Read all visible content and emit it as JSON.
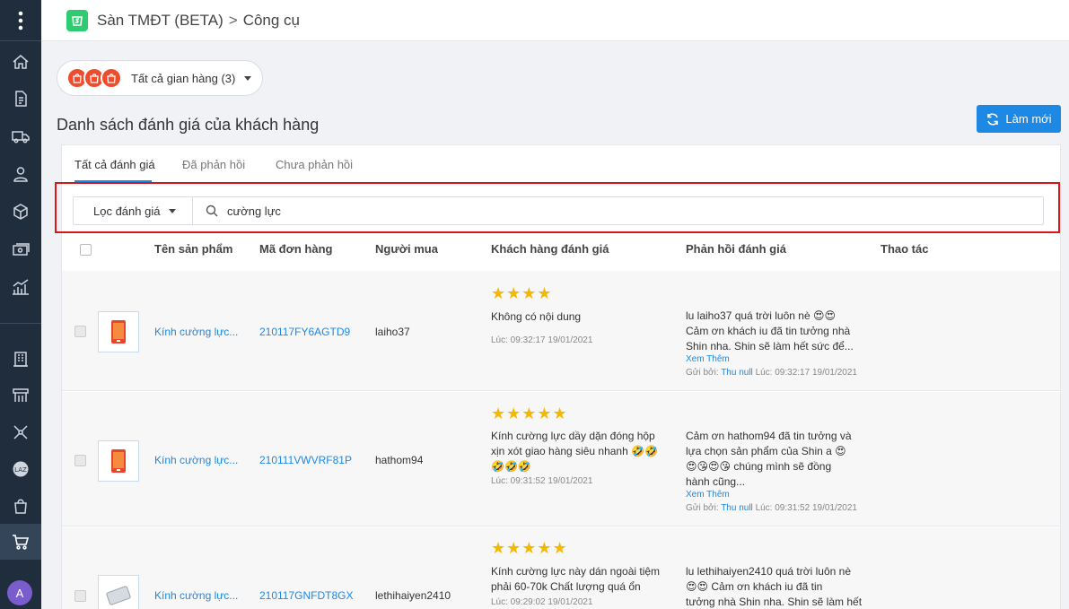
{
  "header": {
    "app": "Sàn TMĐT (BETA)",
    "separator": ">",
    "section": "Công cụ"
  },
  "shop_selector": {
    "label": "Tất cả gian hàng (3)"
  },
  "page_title": "Danh sách đánh giá của khách hàng",
  "refresh_label": "Làm mới",
  "tabs": [
    {
      "label": "Tất cả đánh giá"
    },
    {
      "label": "Đã phản hồi"
    },
    {
      "label": "Chưa phản hồi"
    }
  ],
  "filter": {
    "label": "Lọc đánh giá",
    "search_value": "cường lực"
  },
  "columns": {
    "product": "Tên sản phẩm",
    "order": "Mã đơn hàng",
    "buyer": "Người mua",
    "review": "Khách hàng đánh giá",
    "response": "Phản hồi đánh giá",
    "action": "Thao tác"
  },
  "rows": [
    {
      "product": "Kính cường lực...",
      "order": "210117FY6AGTD9",
      "buyer": "laiho37",
      "rating": 4,
      "stars": "★★★★",
      "review_lines": [
        "Không có nội dung"
      ],
      "review_time": "Lúc: 09:32:17 19/01/2021",
      "response_lines": [
        "lu laiho37 quá trời luôn nè 😍😍",
        "Cảm ơn khách iu đã tin tưởng nhà",
        "Shin nha. Shin sẽ làm hết sức để..."
      ],
      "more": "Xem Thêm",
      "sent_prefix": "Gửi bởi:",
      "sent_user": "Thu null",
      "sent_time": "Lúc: 09:32:17 19/01/2021"
    },
    {
      "product": "Kính cường lực...",
      "order": "210111VWVRF81P",
      "buyer": "hathom94",
      "rating": 5,
      "stars": "★★★★★",
      "review_lines": [
        "Kính cường lực dầy dặn đóng hộp",
        "xịn xót giao hàng siêu nhanh 🤣🤣",
        "🤣🤣🤣"
      ],
      "review_time": "Lúc: 09:31:52 19/01/2021",
      "response_lines": [
        "Cảm ơn hathom94 đã tin tưởng và",
        "lựa chọn sản phẩm của Shin a 😍",
        "😍😘😍😘 chúng mình sẽ đồng",
        "hành cũng..."
      ],
      "more": "Xem Thêm",
      "sent_prefix": "Gửi bởi:",
      "sent_user": "Thu null",
      "sent_time": "Lúc: 09:31:52 19/01/2021"
    },
    {
      "product": "Kính cường lực...",
      "order": "210117GNFDT8GX",
      "buyer": "lethihaiyen2410",
      "rating": 5,
      "stars": "★★★★★",
      "review_lines": [
        "Kính cường lực này dán ngoài tiệm",
        "phải 60-70k Chất lượng quá ổn"
      ],
      "review_time": "Lúc: 09:29:02 19/01/2021",
      "response_lines": [
        "lu lethihaiyen2410 quá trời luôn nè",
        "😍😍 Cảm ơn khách iu đã tin",
        "tưởng nhà Shin nha. Shin sẽ làm hết"
      ]
    }
  ],
  "user": {
    "avatar_letter": "A"
  },
  "colors": {
    "sidebar": "#1f2d3d",
    "accent": "#1e88e5",
    "highlight_box": "#d9161c",
    "star": "#f5b800",
    "logo": "#2ecc71",
    "shopee": "#ee4d2d"
  }
}
